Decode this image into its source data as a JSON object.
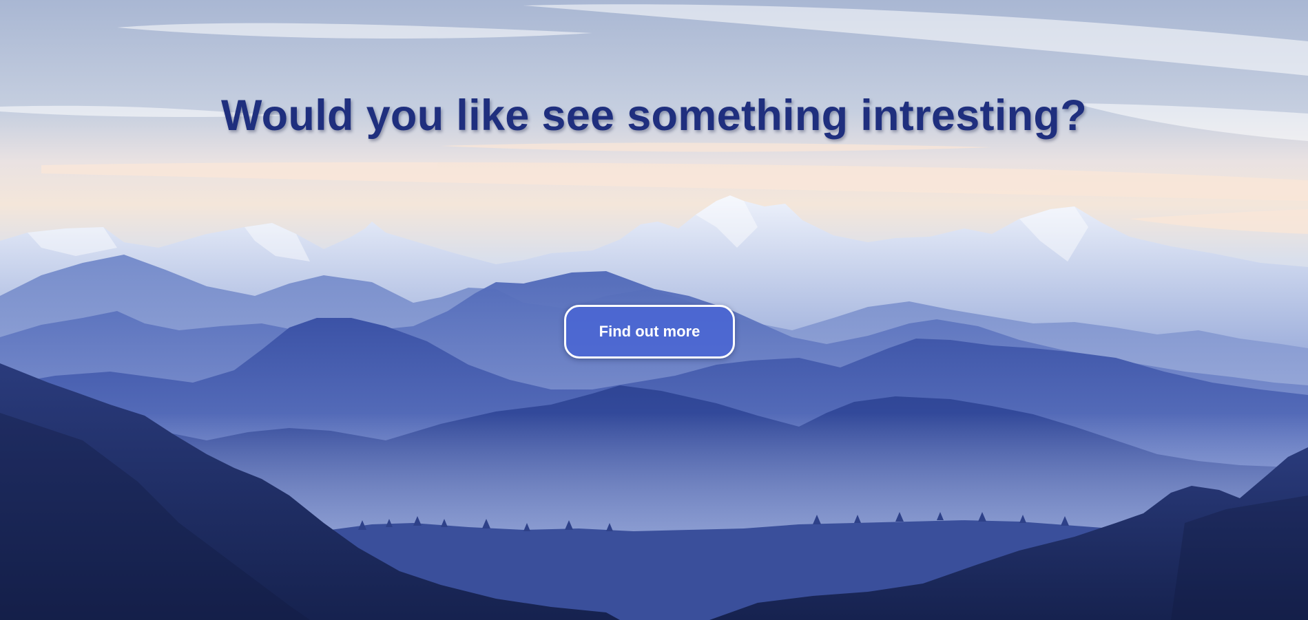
{
  "hero": {
    "title": "Would you like see something intresting?",
    "cta_label": "Find out more"
  },
  "colors": {
    "title": "#1f2f7e",
    "button_fill": "#4864d4",
    "button_border": "#ffffff",
    "sky_top": "#aab8d4",
    "sky_glow": "#f3e3d6",
    "mountains_far": "#8a9fd0",
    "mountains_near": "#1d2c5e"
  }
}
